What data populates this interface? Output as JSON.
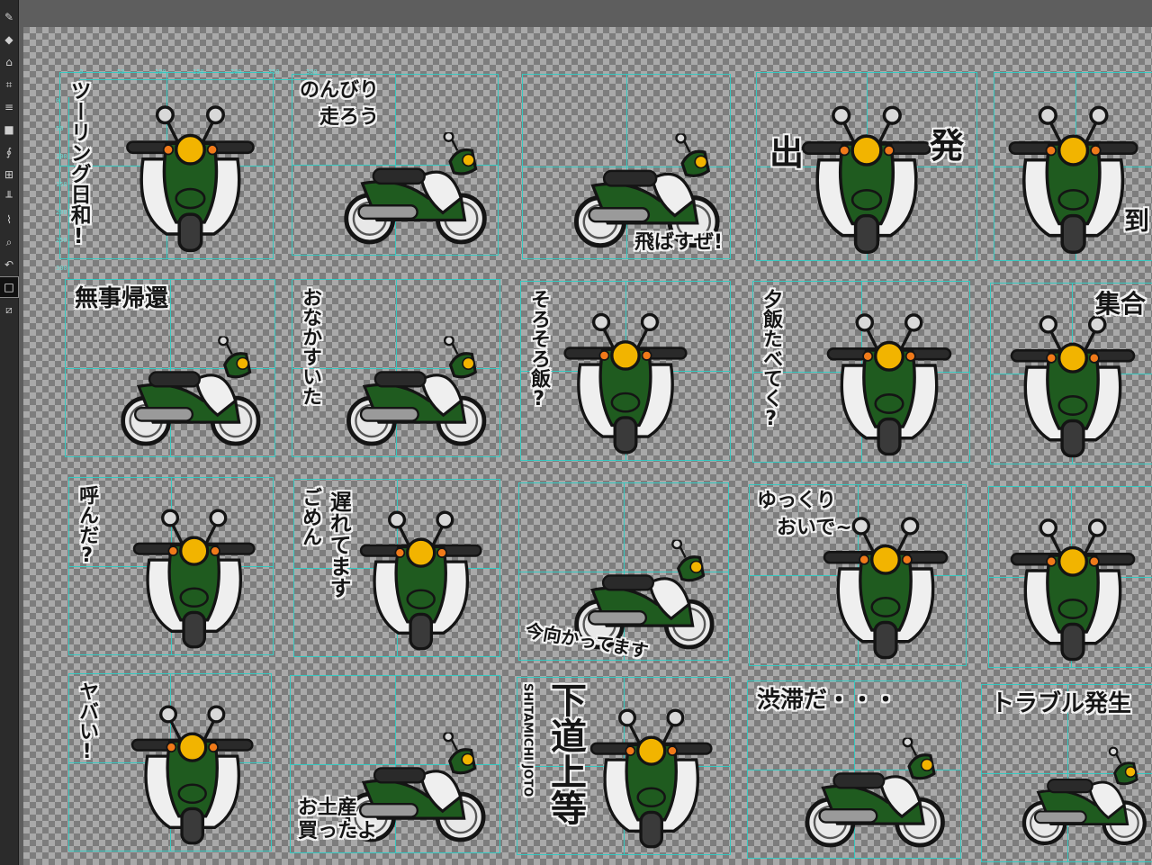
{
  "toolbar": {
    "tools": [
      {
        "name": "pen-icon",
        "glyph": "✎"
      },
      {
        "name": "selection-icon",
        "glyph": "◆"
      },
      {
        "name": "lasso-icon",
        "glyph": "⌂"
      },
      {
        "name": "crop-icon",
        "glyph": "⌗"
      },
      {
        "name": "layers-icon",
        "glyph": "≡"
      },
      {
        "name": "fill-icon",
        "glyph": "■"
      },
      {
        "name": "dropper-icon",
        "glyph": "∮"
      },
      {
        "name": "transform-icon",
        "glyph": "⊞"
      },
      {
        "name": "ruler-icon",
        "glyph": "╨"
      },
      {
        "name": "brush-icon",
        "glyph": "⌇"
      },
      {
        "name": "zoom-icon",
        "glyph": "⌕"
      },
      {
        "name": "hand-icon",
        "glyph": "↶"
      },
      {
        "name": "rect-icon",
        "glyph": "□"
      },
      {
        "name": "color-swap-icon",
        "glyph": "⧄"
      }
    ]
  },
  "ruler": {
    "h_ticks": [
      "0",
      "50",
      "100",
      "150",
      "200",
      "250",
      "300"
    ],
    "v_ticks": [
      "0",
      "50",
      "100",
      "150",
      "200",
      "250",
      "300"
    ]
  },
  "stickers": [
    {
      "id": "s1",
      "text": "ツーリング日和!",
      "style": "vert"
    },
    {
      "id": "s2",
      "text": "のんびり走ろう",
      "style": "horiz2",
      "lines": [
        "のんびり",
        "走ろう"
      ]
    },
    {
      "id": "s3",
      "text": "飛ばすぜ!",
      "style": "horiz"
    },
    {
      "id": "s4",
      "text": "出発",
      "chars": [
        "出",
        "発"
      ],
      "style": "split"
    },
    {
      "id": "s5",
      "text": "到",
      "style": "horiz"
    },
    {
      "id": "s6",
      "text": "無事帰還",
      "style": "horiz"
    },
    {
      "id": "s7",
      "text": "おなかすいた",
      "style": "vert"
    },
    {
      "id": "s8",
      "text": "そろそろ飯?",
      "style": "vert"
    },
    {
      "id": "s9",
      "text": "夕飯たべてく?",
      "style": "vert"
    },
    {
      "id": "s10",
      "text": "集合",
      "style": "horiz"
    },
    {
      "id": "s11",
      "text": "呼んだ?",
      "style": "vert"
    },
    {
      "id": "s12",
      "text": "遅れてます",
      "text2": "ごめん",
      "style": "vert2"
    },
    {
      "id": "s13",
      "text": "今向かってます",
      "style": "horiz"
    },
    {
      "id": "s14",
      "text": "ゆっくりおいで~",
      "lines": [
        "ゆっくり",
        "おいで~"
      ],
      "style": "horiz2"
    },
    {
      "id": "s15",
      "text": "",
      "style": "none"
    },
    {
      "id": "s16",
      "text": "ヤバい!",
      "style": "vert"
    },
    {
      "id": "s17",
      "text": "お土産買ったよ",
      "lines": [
        "お土産",
        "買ったよ"
      ],
      "style": "horiz2"
    },
    {
      "id": "s18",
      "text": "下道上等",
      "roman": "SHITAMICHI JOTO",
      "style": "vert3"
    },
    {
      "id": "s19",
      "text": "渋滞だ・・・",
      "style": "horiz"
    },
    {
      "id": "s20",
      "text": "トラブル発生",
      "style": "horiz"
    }
  ],
  "colors": {
    "body_green": "#1f5b1f",
    "headlight": "#f2b400",
    "outline": "#141414",
    "guide_cyan": "#37c8c0",
    "guide_green": "#3ac83a"
  }
}
